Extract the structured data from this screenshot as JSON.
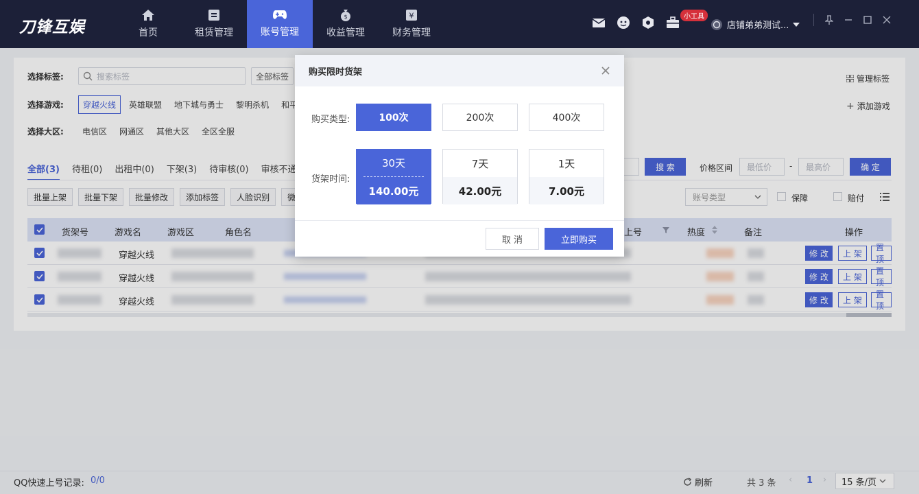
{
  "app": {
    "logo": "刀锋互娱"
  },
  "nav": [
    {
      "label": "首页",
      "icon": "home-icon"
    },
    {
      "label": "租赁管理",
      "icon": "document-icon"
    },
    {
      "label": "账号管理",
      "icon": "gamepad-icon",
      "active": true
    },
    {
      "label": "收益管理",
      "icon": "money-bag-icon"
    },
    {
      "label": "财务管理",
      "icon": "yen-icon"
    }
  ],
  "toolbar": {
    "tools_badge": "小工具",
    "user_name": "店铺弟弟测试..."
  },
  "filters": {
    "tag_label": "选择标签:",
    "tag_search_placeholder": "搜索标签",
    "tag_select": "全部标签",
    "manage_tags": "管理标签",
    "game_label": "选择游戏:",
    "games": [
      "穿越火线",
      "英雄联盟",
      "地下城与勇士",
      "黎明杀机",
      "和平"
    ],
    "add_game": "添加游戏",
    "zone_label": "选择大区:",
    "zones": [
      "电信区",
      "网通区",
      "其他大区",
      "全区全服"
    ]
  },
  "tabs": [
    "全部(3)",
    "待租(0)",
    "出租中(0)",
    "下架(3)",
    "待审核(0)",
    "审核不通过"
  ],
  "actions": [
    "批量上架",
    "批量下架",
    "批量修改",
    "添加标签",
    "人脸识别",
    "微"
  ],
  "search_btn": "搜 索",
  "price_label": "价格区间",
  "price_min": "最低价",
  "price_sep": "-",
  "price_max": "最高价",
  "confirm_btn": "确 定",
  "account_type": "账号类型",
  "guarantee": "保障",
  "compensation": "赔付",
  "table": {
    "headers": {
      "shelf_no": "货架号",
      "game": "游戏名",
      "zone": "游戏区",
      "role": "角色名",
      "login": "上号",
      "heat": "热度",
      "note": "备注",
      "ops": "操作"
    },
    "rows": [
      {
        "game": "穿越火线"
      },
      {
        "game": "穿越火线"
      },
      {
        "game": "穿越火线"
      }
    ],
    "row_actions": {
      "edit": "修 改",
      "shelf": "上 架",
      "top": "置 顶"
    }
  },
  "status": {
    "qq_label": "QQ快速上号记录:",
    "qq_value": "0/0",
    "refresh": "刷新",
    "total": "共 3 条",
    "page": "1",
    "page_size": "15 条/页"
  },
  "modal": {
    "title": "购买限时货架",
    "type_label": "购买类型:",
    "types": [
      "100次",
      "200次",
      "400次"
    ],
    "selected_type": "100次",
    "time_label": "货架时间:",
    "durations": [
      {
        "days": "30天",
        "price": "140.00元"
      },
      {
        "days": "7天",
        "price": "42.00元"
      },
      {
        "days": "1天",
        "price": "7.00元"
      }
    ],
    "selected_duration": "30天",
    "cancel": "取 消",
    "buy": "立即购买"
  },
  "colors": {
    "accent": "#4a65d9",
    "topbar": "#1c2038",
    "badge": "#d6303b"
  }
}
